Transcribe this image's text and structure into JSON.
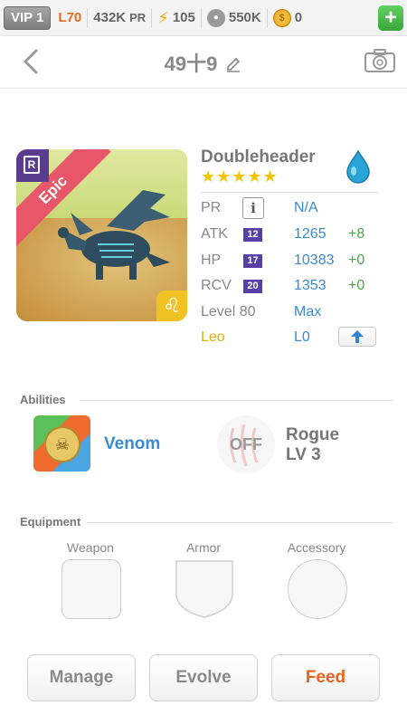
{
  "status_bar": {
    "vip": "VIP 1",
    "level": "L70",
    "power": "432K",
    "power_unit": "PR",
    "energy": "105",
    "food": "550K",
    "coins": "0",
    "add_button": "+"
  },
  "header": {
    "title": "49十9"
  },
  "creature": {
    "name": "Doubleheader",
    "rarity": "Epic",
    "rarity_badge": "R",
    "stars": "★★★★★",
    "zodiac_symbol": "♌",
    "stats": {
      "pr": {
        "label": "PR",
        "value": "N/A",
        "info": "i"
      },
      "atk": {
        "label": "ATK",
        "level": "12",
        "value": "1265",
        "bonus": "+8"
      },
      "hp": {
        "label": "HP",
        "level": "17",
        "value": "10383",
        "bonus": "+0"
      },
      "rcv": {
        "label": "RCV",
        "level": "20",
        "value": "1353",
        "bonus": "+0"
      },
      "level": {
        "label": "Level 80",
        "value": "Max"
      },
      "sign": {
        "label": "Leo",
        "value": "L0"
      }
    }
  },
  "abilities": {
    "section_title": "Abilities",
    "active": {
      "name": "Venom",
      "icon_glyph": "☠"
    },
    "passive": {
      "state": "OFF",
      "name": "Rogue",
      "level": "LV 3"
    }
  },
  "equipment": {
    "section_title": "Equipment",
    "weapon_label": "Weapon",
    "armor_label": "Armor",
    "accessory_label": "Accessory"
  },
  "actions": {
    "manage": "Manage",
    "evolve": "Evolve",
    "feed": "Feed"
  }
}
